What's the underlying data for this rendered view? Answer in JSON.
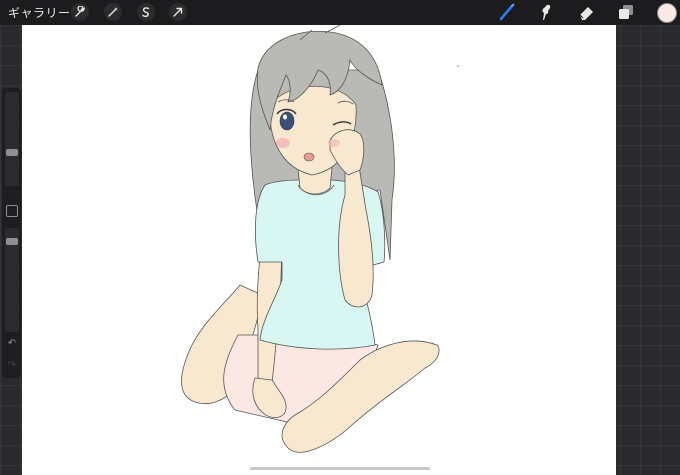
{
  "topbar": {
    "gallery_label": "ギャラリー",
    "actions": [
      {
        "name": "wrench-icon"
      },
      {
        "name": "magic-wand-icon"
      },
      {
        "name": "selection-icon"
      },
      {
        "name": "transform-arrow-icon"
      }
    ],
    "tools": [
      {
        "name": "brush-icon",
        "active": true,
        "color": "#2f7cf6"
      },
      {
        "name": "smudge-icon",
        "active": false
      },
      {
        "name": "eraser-icon",
        "active": false
      },
      {
        "name": "layers-icon",
        "active": false
      }
    ],
    "current_color": "#fbe8e4"
  },
  "sidebar": {
    "brush_size_level": 0.35,
    "opacity_level": 0.1,
    "undo_icon": "↶",
    "redo_icon": "↷"
  },
  "colors": {
    "skin": "#f8e8d0",
    "shirt": "#d8f6f2",
    "shorts": "#fbe8e4",
    "hair": "#b9b9b5",
    "eye": "#3c4f7a",
    "blush": "#f0b4b4"
  }
}
